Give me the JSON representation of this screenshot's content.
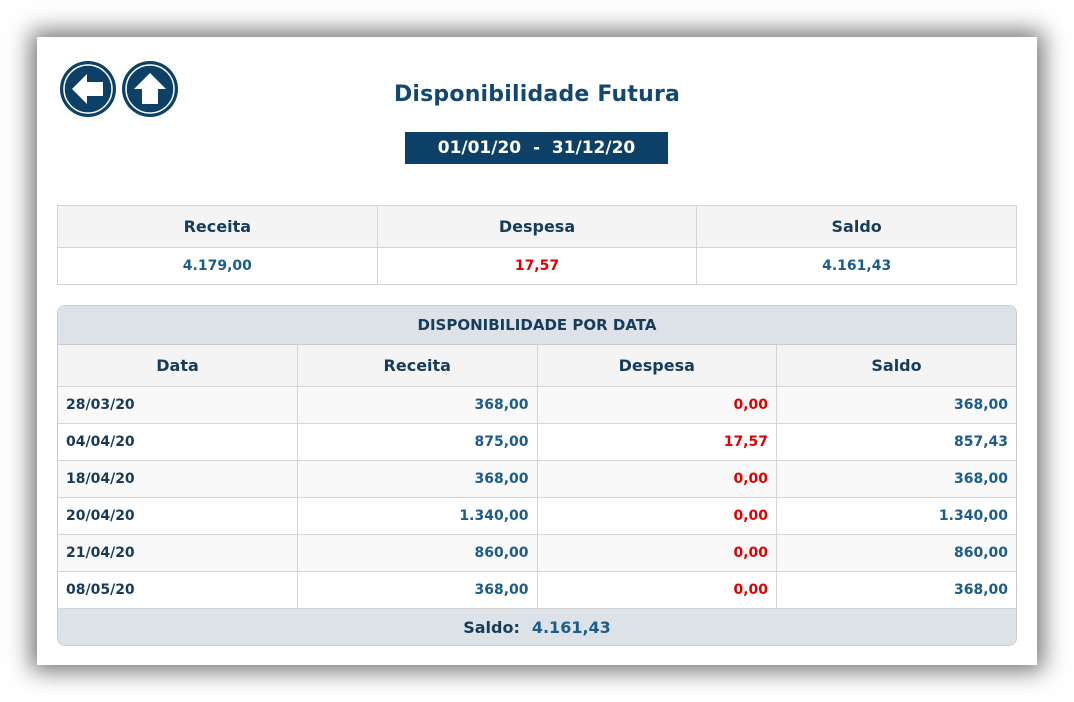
{
  "page": {
    "title": "Disponibilidade Futura",
    "period": "01/01/20  -  31/12/20"
  },
  "navigation": {
    "back_icon": "arrow-left-icon",
    "home_icon": "arrow-up-icon"
  },
  "summary": {
    "headers": [
      "Receita",
      "Despesa",
      "Saldo"
    ],
    "values": [
      "4.179,00",
      "17,57",
      "4.161,43"
    ]
  },
  "detail": {
    "title": "DISPONIBILIDADE POR DATA",
    "headers": [
      "Data",
      "Receita",
      "Despesa",
      "Saldo"
    ],
    "rows": [
      [
        "28/03/20",
        "368,00",
        "0,00",
        "368,00"
      ],
      [
        "04/04/20",
        "875,00",
        "17,57",
        "857,43"
      ],
      [
        "18/04/20",
        "368,00",
        "0,00",
        "368,00"
      ],
      [
        "20/04/20",
        "1.340,00",
        "0,00",
        "1.340,00"
      ],
      [
        "21/04/20",
        "860,00",
        "0,00",
        "860,00"
      ],
      [
        "08/05/20",
        "368,00",
        "0,00",
        "368,00"
      ]
    ],
    "footer_label": "Saldo:",
    "footer_value": "4.161,43"
  },
  "colors": {
    "primary": "#0d4066",
    "text_blue": "#1a5c8a",
    "expense_red": "#e00000",
    "header_bg": "#dde2e9"
  }
}
